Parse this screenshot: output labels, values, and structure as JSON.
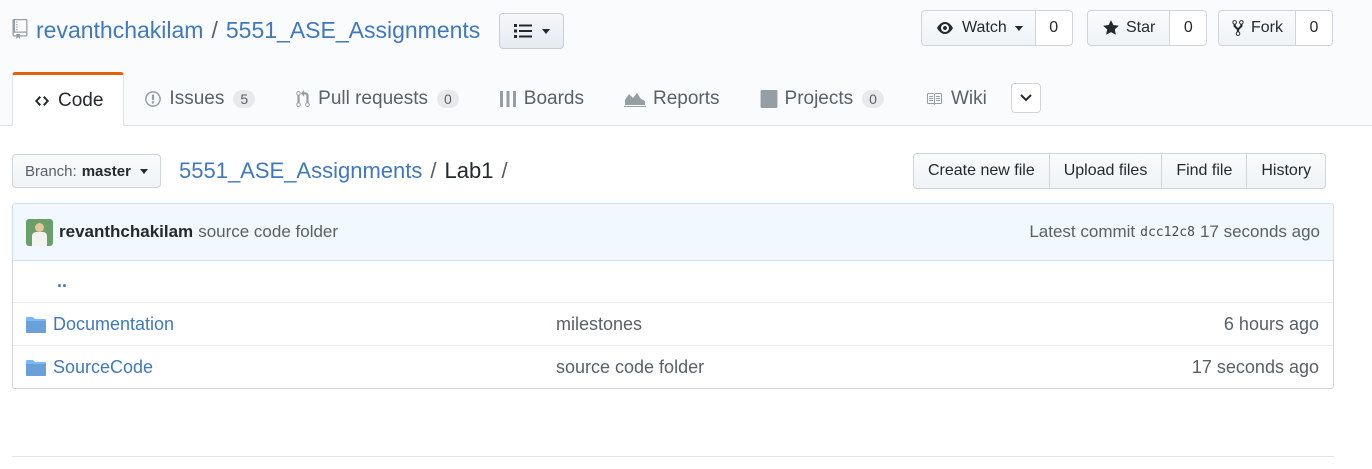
{
  "repo": {
    "owner": "revanthchakilam",
    "separator": "/",
    "name": "5551_ASE_Assignments"
  },
  "social": {
    "watch": {
      "label": "Watch",
      "count": "0"
    },
    "star": {
      "label": "Star",
      "count": "0"
    },
    "fork": {
      "label": "Fork",
      "count": "0"
    }
  },
  "tabs": [
    {
      "label": "Code",
      "icon": "code-icon"
    },
    {
      "label": "Issues",
      "count": "5",
      "icon": "issue-icon"
    },
    {
      "label": "Pull requests",
      "count": "0",
      "icon": "pull-request-icon"
    },
    {
      "label": "Boards",
      "icon": "boards-icon"
    },
    {
      "label": "Reports",
      "icon": "graph-icon"
    },
    {
      "label": "Projects",
      "count": "0",
      "icon": "project-icon"
    },
    {
      "label": "Wiki",
      "icon": "book-icon"
    }
  ],
  "branch": {
    "label": "Branch:",
    "value": "master"
  },
  "breadcrumb": {
    "root": "5551_ASE_Assignments",
    "sep1": "/",
    "current": "Lab1",
    "sep2": "/"
  },
  "file_nav": {
    "create": "Create new file",
    "upload": "Upload files",
    "find": "Find file",
    "history": "History"
  },
  "commit": {
    "author": "revanthchakilam",
    "message": "source code folder",
    "latest_label": "Latest commit",
    "sha": "dcc12c8",
    "age": "17 seconds ago"
  },
  "files": {
    "parent": "..",
    "rows": [
      {
        "name": "Documentation",
        "message": "milestones",
        "age": "6 hours ago"
      },
      {
        "name": "SourceCode",
        "message": "source code folder",
        "age": "17 seconds ago"
      }
    ]
  }
}
